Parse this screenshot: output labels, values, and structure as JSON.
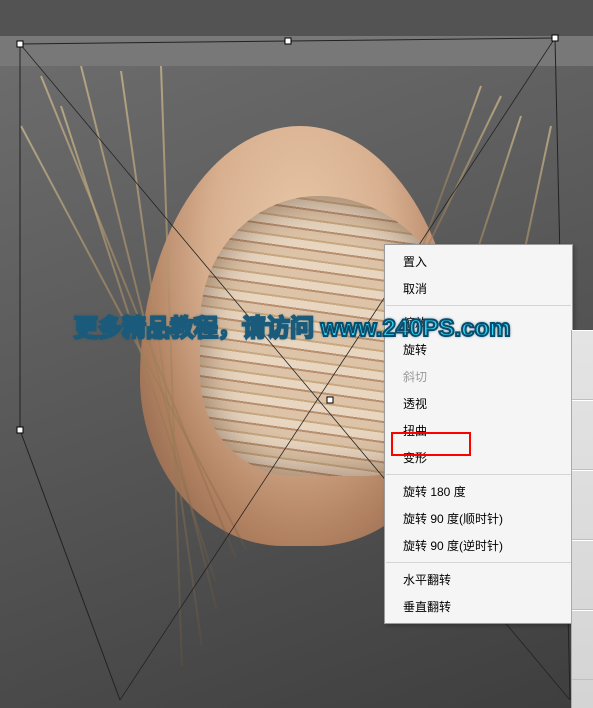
{
  "context_menu": {
    "items": [
      {
        "label": "置入",
        "type": "item"
      },
      {
        "label": "取消",
        "type": "item"
      },
      {
        "type": "sep"
      },
      {
        "label": "缩放",
        "type": "item"
      },
      {
        "label": "旋转",
        "type": "item"
      },
      {
        "label": "斜切",
        "type": "item",
        "disabled": true
      },
      {
        "label": "透视",
        "type": "item"
      },
      {
        "label": "扭曲",
        "type": "item"
      },
      {
        "label": "变形",
        "type": "item",
        "highlighted": true
      },
      {
        "type": "sep"
      },
      {
        "label": "旋转 180 度",
        "type": "item"
      },
      {
        "label": "旋转 90 度(顺时针)",
        "type": "item"
      },
      {
        "label": "旋转 90 度(逆时针)",
        "type": "item"
      },
      {
        "type": "sep"
      },
      {
        "label": "水平翻转",
        "type": "item"
      },
      {
        "label": "垂直翻转",
        "type": "item"
      }
    ]
  },
  "watermark": {
    "text_before": "更多精品教程，请访问 ",
    "text_link": "www.240PS.com"
  }
}
